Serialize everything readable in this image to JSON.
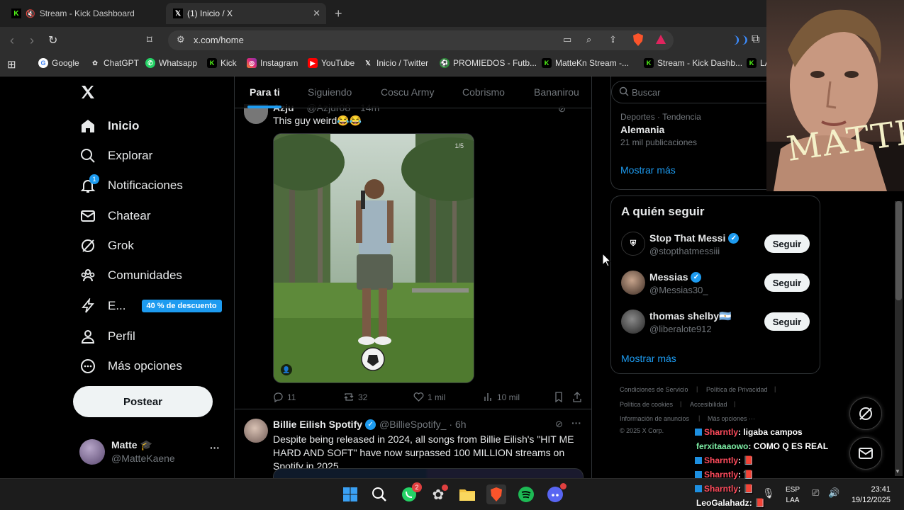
{
  "browser": {
    "tabs": [
      {
        "title": "Stream - Kick Dashboard",
        "favicon": "kick-logo",
        "muted": true
      },
      {
        "title": "(1) Inicio / X",
        "favicon": "x-logo",
        "active": true
      }
    ],
    "url": "x.com/home",
    "bookmarks": [
      {
        "label": "Google",
        "icon": "google-icon"
      },
      {
        "label": "ChatGPT",
        "icon": "chatgpt-icon"
      },
      {
        "label": "Whatsapp",
        "icon": "whatsapp-icon"
      },
      {
        "label": "Kick",
        "icon": "kick-icon"
      },
      {
        "label": "Instagram",
        "icon": "instagram-icon"
      },
      {
        "label": "YouTube",
        "icon": "youtube-icon"
      },
      {
        "label": "Inicio / Twitter",
        "icon": "x-icon"
      },
      {
        "label": "PROMIEDOS - Futb...",
        "icon": "promiedos-icon"
      },
      {
        "label": "MatteKn Stream -...",
        "icon": "kick-icon"
      },
      {
        "label": "Stream - Kick Dashb...",
        "icon": "kick-icon"
      },
      {
        "label": "LA",
        "icon": "kick-icon"
      }
    ]
  },
  "nav": {
    "items": [
      {
        "label": "Inicio",
        "icon": "home-icon"
      },
      {
        "label": "Explorar",
        "icon": "search-icon"
      },
      {
        "label": "Notificaciones",
        "icon": "bell-icon",
        "badge": "1"
      },
      {
        "label": "Chatear",
        "icon": "mail-icon"
      },
      {
        "label": "Grok",
        "icon": "grok-icon"
      },
      {
        "label": "Comunidades",
        "icon": "communities-icon"
      },
      {
        "label": "E...",
        "icon": "lightning-icon",
        "promo": "40 % de descuento"
      },
      {
        "label": "Perfil",
        "icon": "person-icon"
      },
      {
        "label": "Más opciones",
        "icon": "more-circle-icon"
      }
    ],
    "post_button": "Postear",
    "profile": {
      "name": "Matte",
      "emoji": "🎓",
      "handle": "@MatteKaene",
      "more": "···"
    }
  },
  "feed": {
    "tabs": [
      "Para ti",
      "Siguiendo",
      "Coscu Army",
      "Cobrismo",
      "Bananirou"
    ],
    "tweet1": {
      "author_partial": "Azju",
      "handle_partial": "@Azjur08",
      "time_partial": "14m",
      "text": "This guy weird😂😂",
      "media_counter": "1/5",
      "actions": {
        "replies": "11",
        "reposts": "32",
        "likes": "1 mil",
        "views": "10 mil"
      }
    },
    "tweet2": {
      "author": "Billie Eilish Spotify",
      "handle": "@BillieSpotify_",
      "time": "· 6h",
      "text": "Despite being released in 2024, all songs from Billie Eilish's \"HIT ME HARD AND SOFT\" have now surpassed 100 MILLION streams on Spotify in 2025."
    }
  },
  "right": {
    "search_placeholder": "Buscar",
    "trend": {
      "category": "Deportes · Tendencia",
      "name": "Alemania",
      "count": "21 mil publicaciones",
      "more": "Mostrar más"
    },
    "who_to_follow": {
      "title": "A quién seguir",
      "accounts": [
        {
          "name": "Stop That Messi",
          "handle": "@stopthatmessiii",
          "verified": true,
          "button": "Seguir"
        },
        {
          "name": "Messias",
          "handle": "@Messias30_",
          "verified": true,
          "button": "Seguir"
        },
        {
          "name": "thomas shelby🇦🇷",
          "handle": "@liberalote912",
          "verified": false,
          "button": "Seguir"
        }
      ],
      "more": "Mostrar más"
    },
    "footer": [
      "Condiciones de Servicio",
      "Política de Privacidad",
      "Política de cookies",
      "Accesibilidad",
      "Información de anuncios",
      "Más opciones ···",
      "© 2025 X Corp."
    ]
  },
  "chat": [
    {
      "user": "Sharntly",
      "msg": ": ligaba campos",
      "color": "red",
      "tag": true
    },
    {
      "user": "ferxitaaaowo",
      "msg": ": COMO Q ES REAL",
      "color": "green",
      "tag": false
    },
    {
      "user": "Sharntly",
      "msg": ": 📕",
      "color": "red",
      "tag": true
    },
    {
      "user": "Sharntly",
      "msg": ": 📕",
      "color": "red",
      "tag": true
    },
    {
      "user": "Sharntly",
      "msg": ": 📕",
      "color": "red",
      "tag": true
    },
    {
      "user": "LeoGalahadz",
      "msg": ": 📕",
      "color": "white",
      "tag": false
    }
  ],
  "webcam": {
    "overlay_text": "MATTE"
  },
  "taskbar": {
    "lang": "ESP",
    "lang2": "LAA",
    "time": "23:41",
    "date": "19/12/2025",
    "whatsapp_badge": "2"
  }
}
